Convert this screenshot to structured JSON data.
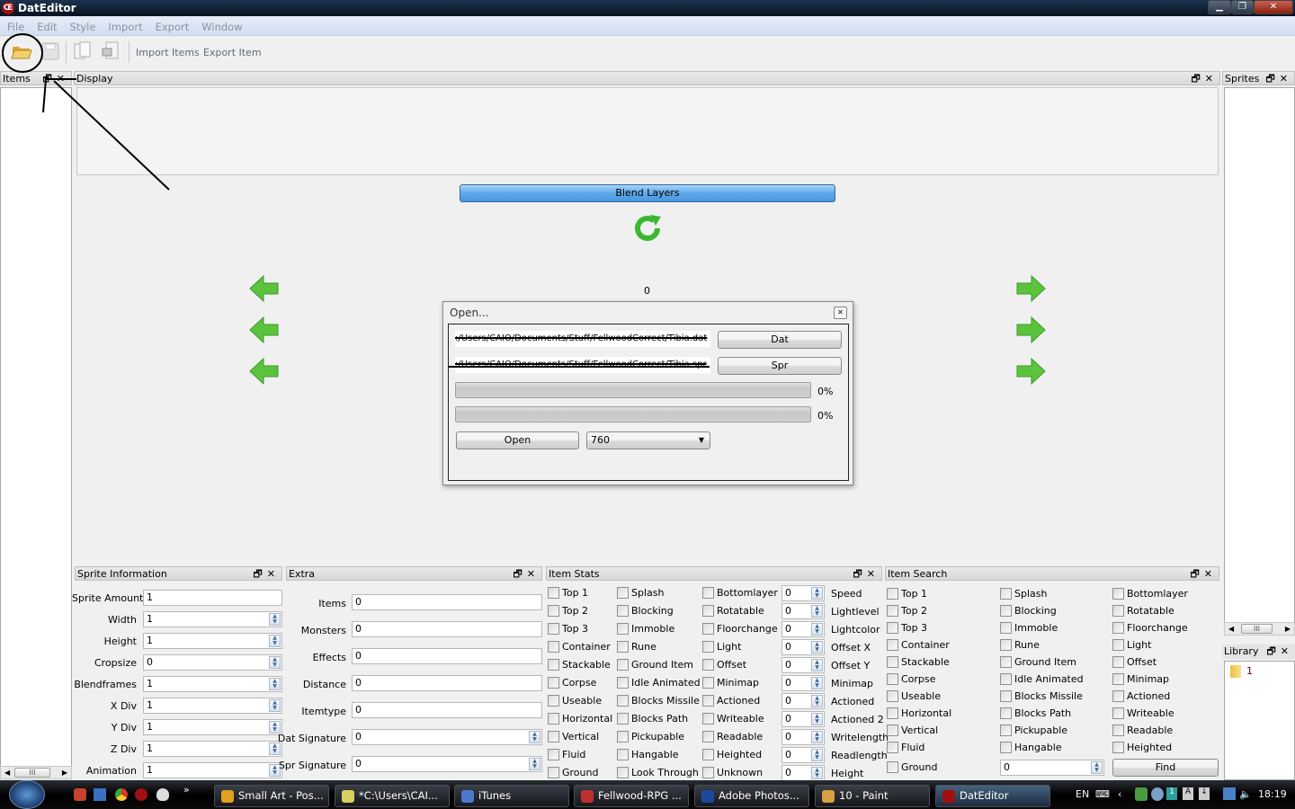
{
  "window": {
    "title": "DatEditor",
    "controls": [
      "minimize",
      "maximize",
      "close"
    ]
  },
  "menu": [
    "File",
    "Edit",
    "Style",
    "Import",
    "Export",
    "Window"
  ],
  "toolbar": {
    "import_items": "Import Items",
    "export_item": "Export Item",
    "icons": [
      "open-folder-icon",
      "save-icon",
      "copy-icon",
      "export-icon"
    ]
  },
  "panels": {
    "items": {
      "title": "Items"
    },
    "display": {
      "title": "Display",
      "blend_layers": "Blend Layers",
      "counter": "0"
    },
    "sprites": {
      "title": "Sprites"
    },
    "library": {
      "title": "Library",
      "items": [
        "1"
      ]
    },
    "sprite_info": {
      "title": "Sprite Information",
      "fields": [
        {
          "label": "Sprite Amount",
          "value": "1",
          "spin": false
        },
        {
          "label": "Width",
          "value": "1",
          "spin": true
        },
        {
          "label": "Height",
          "value": "1",
          "spin": true
        },
        {
          "label": "Cropsize",
          "value": "0",
          "spin": true
        },
        {
          "label": "Blendframes",
          "value": "1",
          "spin": true
        },
        {
          "label": "X Div",
          "value": "1",
          "spin": true
        },
        {
          "label": "Y Div",
          "value": "1",
          "spin": true
        },
        {
          "label": "Z Div",
          "value": "1",
          "spin": true
        },
        {
          "label": "Animation",
          "value": "1",
          "spin": true
        }
      ]
    },
    "extra": {
      "title": "Extra",
      "fields": [
        {
          "label": "Items",
          "value": "0",
          "spin": false
        },
        {
          "label": "Monsters",
          "value": "0",
          "spin": false
        },
        {
          "label": "Effects",
          "value": "0",
          "spin": false
        },
        {
          "label": "Distance",
          "value": "0",
          "spin": false
        },
        {
          "label": "Itemtype",
          "value": "0",
          "spin": false
        },
        {
          "label": "Dat Signature",
          "value": "0",
          "spin": true
        },
        {
          "label": "Spr Signature",
          "value": "0",
          "spin": true
        }
      ]
    },
    "item_stats": {
      "title": "Item Stats",
      "col1": [
        "Top 1",
        "Top 2",
        "Top 3",
        "Container",
        "Stackable",
        "Corpse",
        "Useable",
        "Horizontal",
        "Vertical",
        "Fluid",
        "Ground"
      ],
      "col2": [
        "Splash",
        "Blocking",
        "Immoble",
        "Rune",
        "Ground Item",
        "Idle Animated",
        "Blocks Missile",
        "Blocks Path",
        "Pickupable",
        "Hangable",
        "Look Through"
      ],
      "col3": [
        "Bottomlayer",
        "Rotatable",
        "Floorchange",
        "Light",
        "Offset",
        "Minimap",
        "Actioned",
        "Writeable",
        "Readable",
        "Heighted",
        "Unknown"
      ],
      "spinners": [
        {
          "label": "Speed",
          "value": "0"
        },
        {
          "label": "Lightlevel",
          "value": "0"
        },
        {
          "label": "Lightcolor",
          "value": "0"
        },
        {
          "label": "Offset X",
          "value": "0"
        },
        {
          "label": "Offset Y",
          "value": "0"
        },
        {
          "label": "Minimap",
          "value": "0"
        },
        {
          "label": "Actioned",
          "value": "0"
        },
        {
          "label": "Actioned 2",
          "value": "0"
        },
        {
          "label": "Writelength",
          "value": "0"
        },
        {
          "label": "Readlength",
          "value": "0"
        },
        {
          "label": "Height",
          "value": "0"
        }
      ]
    },
    "item_search": {
      "title": "Item Search",
      "col1": [
        "Top 1",
        "Top 2",
        "Top 3",
        "Container",
        "Stackable",
        "Corpse",
        "Useable",
        "Horizontal",
        "Vertical",
        "Fluid",
        "Ground"
      ],
      "col2": [
        "Splash",
        "Blocking",
        "Immoble",
        "Rune",
        "Ground Item",
        "Idle Animated",
        "Blocks Missile",
        "Blocks Path",
        "Pickupable",
        "Hangable"
      ],
      "col3": [
        "Bottomlayer",
        "Rotatable",
        "Floorchange",
        "Light",
        "Offset",
        "Minimap",
        "Actioned",
        "Writeable",
        "Readable",
        "Heighted"
      ],
      "search_value": "0",
      "find_label": "Find"
    }
  },
  "dialog": {
    "title": "Open...",
    "dat_path": ":/Users/CAIO/Documents/Stuff/FellwoodCorrect/Tibia.dat",
    "spr_path": ":/Users/CAIO/Documents/Stuff/FellwoodCorrect/Tibia.spr",
    "dat_button": "Dat",
    "spr_button": "Spr",
    "progress1": "0%",
    "progress2": "0%",
    "progress1_value": 0,
    "progress2_value": 0,
    "open_button": "Open",
    "version": "760"
  },
  "taskbar": {
    "tasks": [
      {
        "label": "Small Art - Pos...",
        "color": "#e0a020"
      },
      {
        "label": "*C:\\Users\\CAI...",
        "color": "#d8d060"
      },
      {
        "label": "iTunes",
        "color": "#4a7ad0"
      },
      {
        "label": "Fellwood-RPG ...",
        "color": "#c03030"
      },
      {
        "label": "Adobe Photos...",
        "color": "#1a4aa0"
      },
      {
        "label": "10 - Paint",
        "color": "#d8a040"
      },
      {
        "label": "DatEditor",
        "color": "#a01010"
      }
    ],
    "language": "EN",
    "clock": "18:19"
  },
  "colors": {
    "accent_blue": "#5ea8e8",
    "arrow_green": "#5cc43c"
  }
}
